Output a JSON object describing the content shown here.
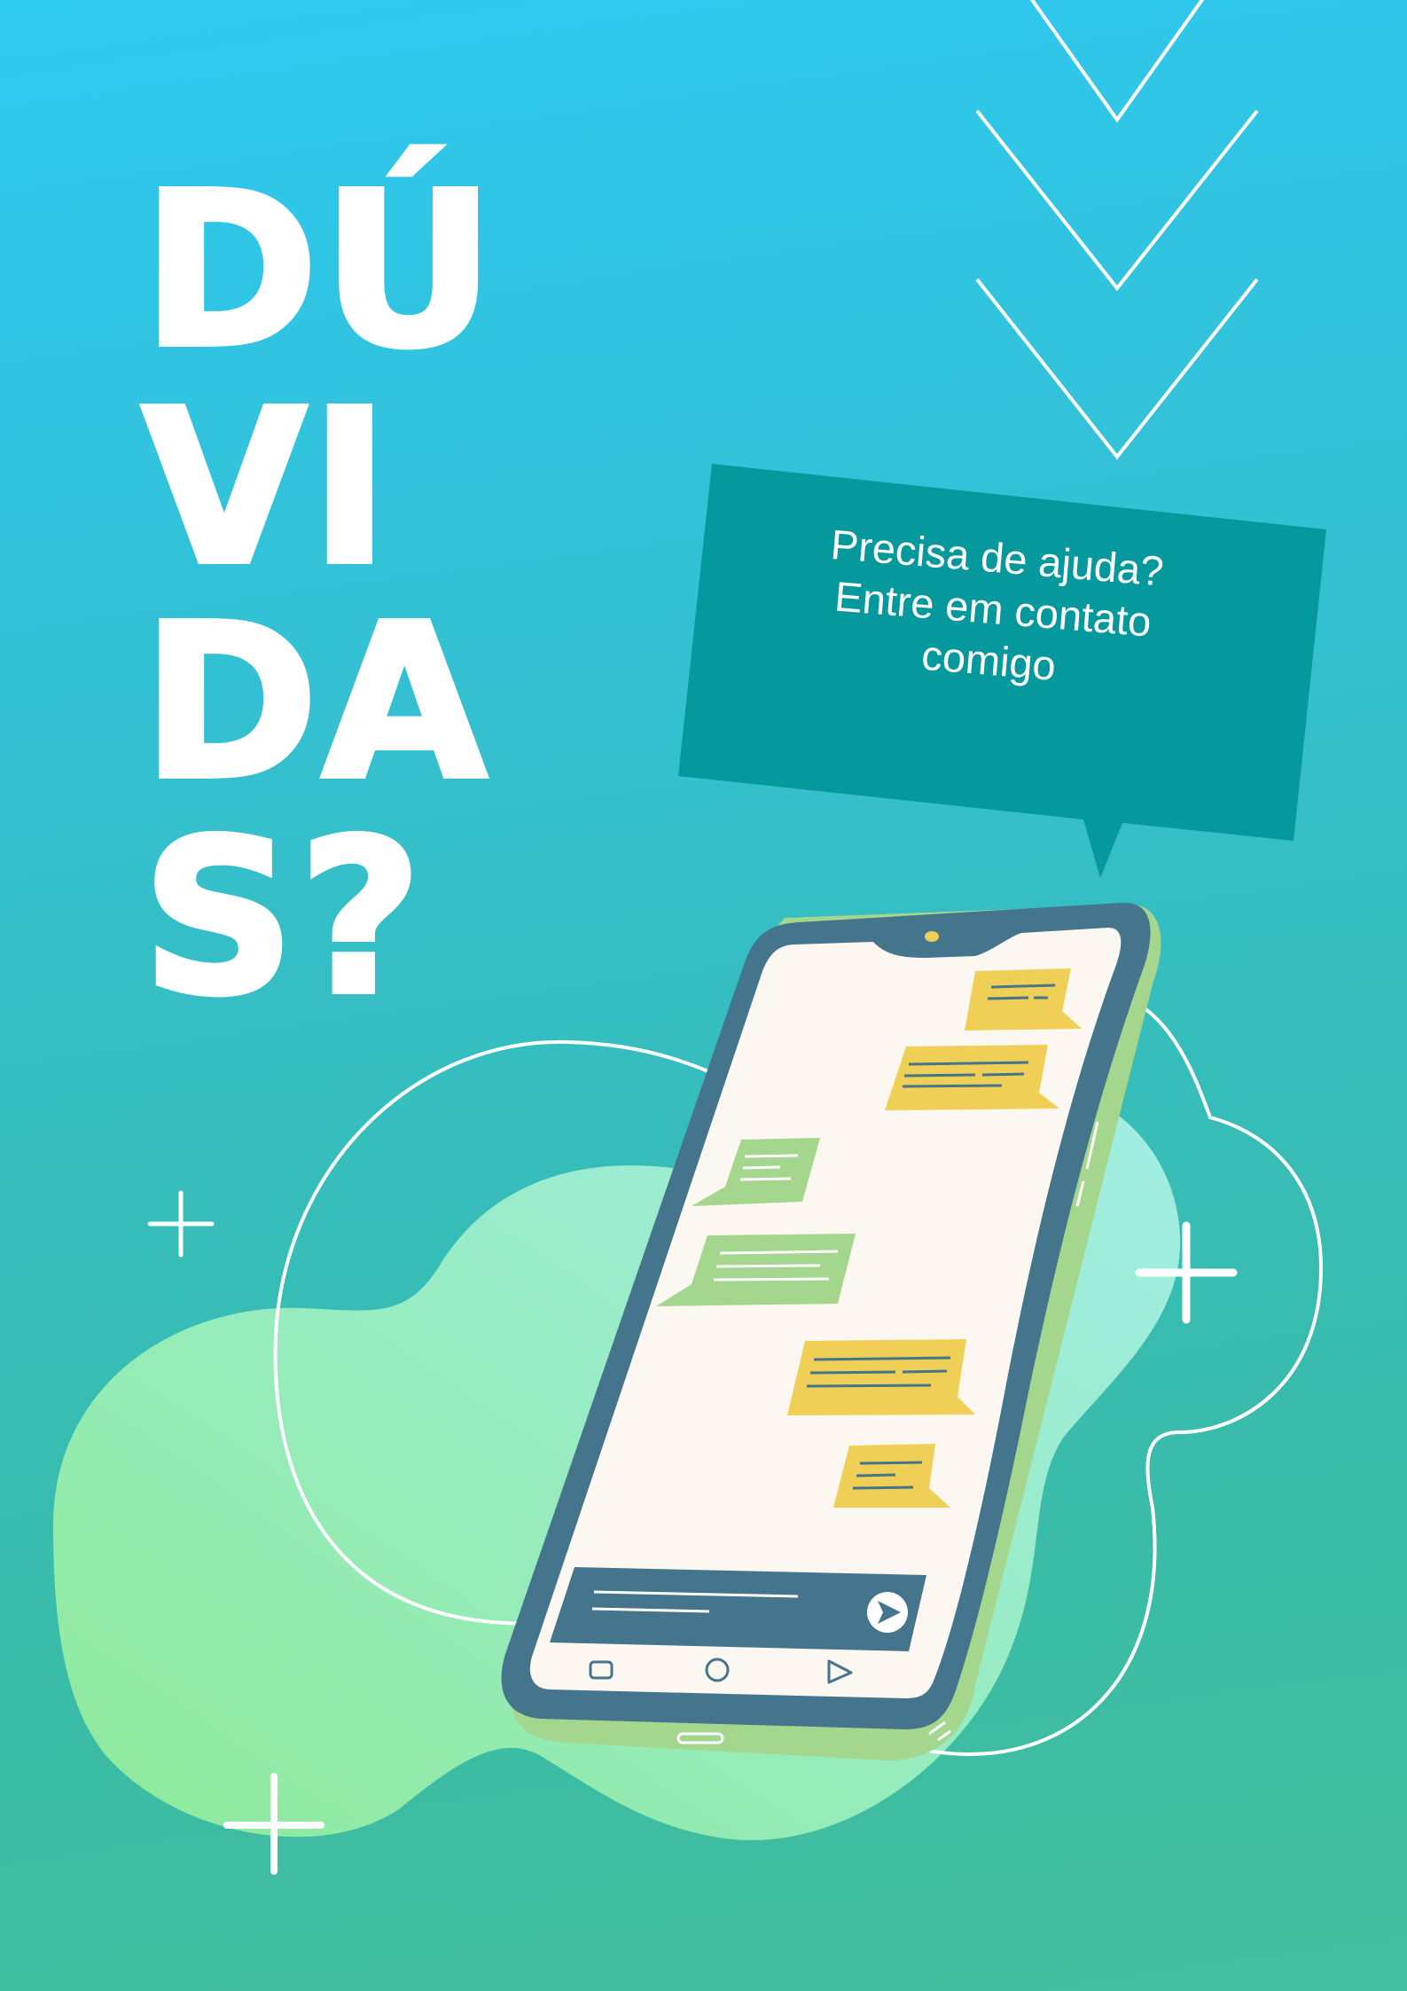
{
  "heading": {
    "line1": "DÚ",
    "line2": "VI",
    "line3": "DA",
    "line4": "S?"
  },
  "speech_bubble": {
    "line1": "Precisa de ajuda?",
    "line2": "Entre em contato",
    "line3": "comigo"
  },
  "colors": {
    "background_top": "#2ec9f2",
    "background_bottom": "#44bf9c",
    "heading_text": "#ffffff",
    "bubble_fill": "#05999e",
    "phone_frame": "#44758c",
    "phone_screen": "#fcf7f1",
    "message_outgoing": "#f0cf56",
    "message_incoming": "#a4d78d",
    "blob_green": "#95eaa6"
  },
  "icons": [
    "chevron-down-icon",
    "plus-icon",
    "send-icon",
    "back-nav-icon",
    "home-nav-icon",
    "recent-apps-icon"
  ]
}
